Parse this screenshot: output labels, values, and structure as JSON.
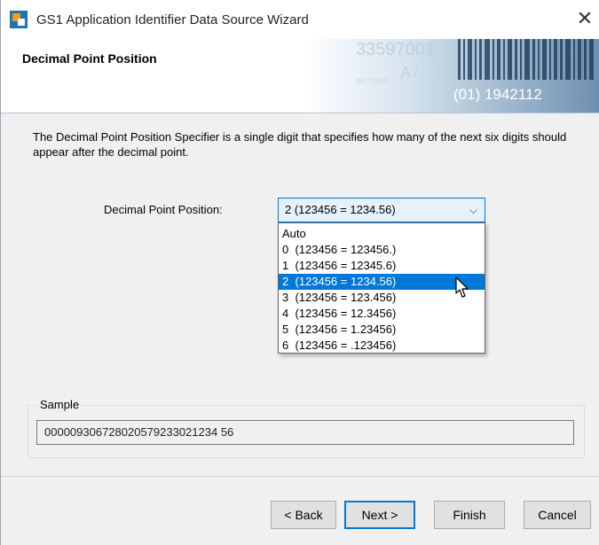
{
  "window": {
    "title": "GS1 Application Identifier Data Source Wizard",
    "close_glyph": "✕"
  },
  "header": {
    "page_title": "Decimal Point Position",
    "banner_text_top": "33597001",
    "banner_text_mid": "A7-11",
    "banner_text_bottom": "(01) 1942112",
    "banner_text_small": "86172900"
  },
  "description": "The Decimal Point Position Specifier is a single digit that specifies how many of the next six digits should appear after the decimal point.",
  "decimal_point": {
    "label": "Decimal Point Position:",
    "selected_value": "2  (123456 = 1234.56)",
    "arrow_glyph": "⌵",
    "options": [
      "Auto",
      "0  (123456 = 123456.)",
      "1  (123456 = 12345.6)",
      "2  (123456 = 1234.56)",
      "3  (123456 = 123.456)",
      "4  (123456 = 12.3456)",
      "5  (123456 = 1.23456)",
      "6  (123456 = .123456)"
    ],
    "highlighted_option": "2  (123456 = 1234.56)"
  },
  "sample": {
    "label": "Sample",
    "value": "000009306728020579233021234 56"
  },
  "buttons": {
    "back": "< Back",
    "next": "Next >",
    "finish": "Finish",
    "cancel": "Cancel"
  },
  "icons": {
    "app": "bartender-app-icon",
    "close": "close-icon",
    "chevron": "chevron-down-icon",
    "cursor": "mouse-pointer-icon"
  },
  "colors": {
    "accent": "#0078d7",
    "selection_text": "#ffffff",
    "combo_background": "#e5f1fb",
    "app_icon_blue": "#1f73b7",
    "app_icon_orange": "#f39a21"
  }
}
